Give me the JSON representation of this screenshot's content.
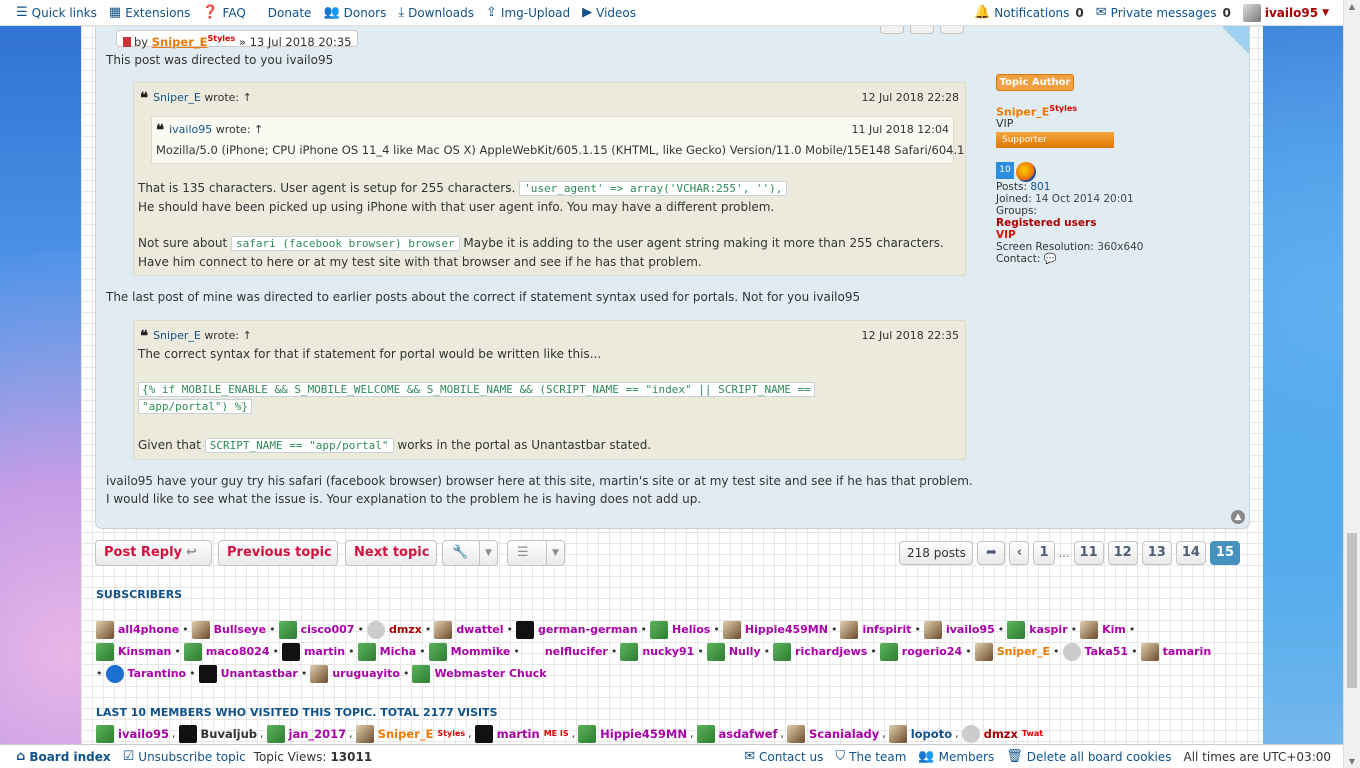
{
  "topbar": {
    "quick_links": "Quick links",
    "extensions": "Extensions",
    "faq": "FAQ",
    "donate": "Donate",
    "donors": "Donors",
    "downloads": "Downloads",
    "img_upload": "Img-Upload",
    "videos": "Videos",
    "notifications": "Notifications",
    "notifications_count": "0",
    "private_messages": "Private messages",
    "pm_count": "0",
    "username": "ivailo95"
  },
  "post": {
    "author_prefix": "by",
    "author_name": "Sniper_E",
    "author_style": "Styles",
    "author_sep": "»",
    "author_date": "13 Jul 2018 20:35",
    "line1": "This post was directed to you ivailo95",
    "quote1": {
      "author": "Sniper_E",
      "wrote": "wrote:",
      "arrow": "↑",
      "time": "12 Jul 2018 22:28",
      "inner": {
        "author": "ivailo95",
        "wrote": "wrote:",
        "arrow": "↑",
        "time": "11 Jul 2018 12:04",
        "text": "Mozilla/5.0 (iPhone; CPU iPhone OS 11_4 like Mac OS X) AppleWebKit/605.1.15 (KHTML, like Gecko) Version/11.0 Mobile/15E148 Safari/604.1"
      },
      "p1a": "That is 135 characters. User agent is setup for 255 characters.",
      "code1": "'user_agent' => array('VCHAR:255', ''),",
      "p1b": "He should have been picked up using iPhone with that user agent info. You may have a different problem.",
      "p2a": "Not sure about",
      "code2": "safari (facebook browser) browser",
      "p2b": "Maybe it is adding to the user agent string making it more than 255 characters.",
      "p2c": "Have him connect to here or at my test site with that browser and see if he has that problem."
    },
    "line2": "The last post of mine was directed to earlier posts about the correct if statement syntax used for portals. Not for you ivailo95",
    "quote2": {
      "author": "Sniper_E",
      "wrote": "wrote:",
      "arrow": "↑",
      "time": "12 Jul 2018 22:35",
      "p1": "The correct syntax for that if statement for portal would be written like this...",
      "code_a": "{% if MOBILE_ENABLE && S_MOBILE_WELCOME && S_MOBILE_NAME && (SCRIPT_NAME == \"index\" || SCRIPT_NAME ==",
      "code_b": "\"app/portal\") %}",
      "p2a": "Given that",
      "code3": "SCRIPT_NAME == \"app/portal\"",
      "p2b": "works in the portal as Unantastbar stated."
    },
    "line3": "ivailo95 have your guy try his safari (facebook browser) browser here at this site, martin's site or at my test site and see if he has that problem.",
    "line4": "I would like to see what the issue is. Your explanation to the problem he is having does not add up."
  },
  "profile": {
    "rank": "Topic Author",
    "name": "Sniper_E",
    "name_style": "Styles",
    "title": "VIP",
    "badge": "Supporter",
    "os_badge": "10",
    "posts_label": "Posts:",
    "posts": "801",
    "joined_label": "Joined:",
    "joined": "14 Oct 2014 20:01",
    "groups_label": "Groups:",
    "group1": "Registered users",
    "group2": "VIP",
    "screen_label": "Screen Resolution:",
    "screen": "360x640",
    "contact_label": "Contact:"
  },
  "actions": {
    "post_reply": "Post Reply",
    "previous_topic": "Previous topic",
    "next_topic": "Next topic",
    "post_count": "218 posts",
    "pages": [
      "1",
      "11",
      "12",
      "13",
      "14",
      "15"
    ],
    "ellipsis": "…",
    "current_page": "15"
  },
  "subscribers": {
    "title": "SUBSCRIBERS",
    "list": [
      {
        "name": "all4phone",
        "color": "#aa00aa"
      },
      {
        "name": "Bullseye",
        "color": "#aa00aa"
      },
      {
        "name": "cisco007",
        "color": "#aa00aa"
      },
      {
        "name": "dmzx",
        "color": "#aa0000"
      },
      {
        "name": "dwattel",
        "color": "#aa00aa"
      },
      {
        "name": "german-german",
        "color": "#aa00aa"
      },
      {
        "name": "Helios",
        "color": "#aa00aa"
      },
      {
        "name": "Hippie459MN",
        "color": "#aa00aa"
      },
      {
        "name": "infspirit",
        "color": "#aa00aa"
      },
      {
        "name": "ivailo95",
        "color": "#aa00aa"
      },
      {
        "name": "kaspir",
        "color": "#aa00aa"
      },
      {
        "name": "Kim",
        "color": "#aa00aa"
      },
      {
        "name": "Kinsman",
        "color": "#aa00aa"
      },
      {
        "name": "maco8024",
        "color": "#aa00aa"
      },
      {
        "name": "martin",
        "color": "#aa00aa"
      },
      {
        "name": "Micha",
        "color": "#aa00aa"
      },
      {
        "name": "Mommike",
        "color": "#aa00aa"
      },
      {
        "name": "nelflucifer",
        "color": "#aa00aa"
      },
      {
        "name": "nucky91",
        "color": "#aa00aa"
      },
      {
        "name": "Nully",
        "color": "#aa00aa"
      },
      {
        "name": "richardjews",
        "color": "#aa00aa"
      },
      {
        "name": "rogerio24",
        "color": "#aa00aa"
      },
      {
        "name": "Sniper_E",
        "color": "#ec7a00"
      },
      {
        "name": "Taka51",
        "color": "#aa00aa"
      },
      {
        "name": "tamarin",
        "color": "#aa00aa"
      },
      {
        "name": "Tarantino",
        "color": "#aa00aa"
      },
      {
        "name": "Unantastbar",
        "color": "#aa00aa"
      },
      {
        "name": "uruguayito",
        "color": "#aa00aa"
      },
      {
        "name": "Webmaster Chuck",
        "color": "#aa00aa"
      }
    ]
  },
  "visitors": {
    "title": "LAST 10 MEMBERS WHO VISITED THIS TOPIC. TOTAL 2177 VISITS",
    "list": [
      {
        "name": "ivailo95",
        "color": "#aa00aa",
        "sup": ""
      },
      {
        "name": "Buvaljub",
        "color": "#333333",
        "sup": ""
      },
      {
        "name": "jan_2017",
        "color": "#aa00aa",
        "sup": ""
      },
      {
        "name": "Sniper_E",
        "color": "#ec7a00",
        "sup": "Styles"
      },
      {
        "name": "martin",
        "color": "#aa00aa",
        "sup": "ME IS"
      },
      {
        "name": "Hippie459MN",
        "color": "#aa00aa",
        "sup": ""
      },
      {
        "name": "asdafwef",
        "color": "#aa00aa",
        "sup": ""
      },
      {
        "name": "Scanialady",
        "color": "#aa00aa",
        "sup": ""
      },
      {
        "name": "lopoto",
        "color": "#105289",
        "sup": ""
      },
      {
        "name": "dmzx",
        "color": "#aa0000",
        "sup": "Twat"
      }
    ]
  },
  "botbar": {
    "board_index": "Board index",
    "unsubscribe": "Unsubscribe topic",
    "views_label": "Topic Views:",
    "views": "13011",
    "contact": "Contact us",
    "team": "The team",
    "members": "Members",
    "delete_cookies": "Delete all board cookies",
    "timezone": "All times are UTC+03:00"
  }
}
